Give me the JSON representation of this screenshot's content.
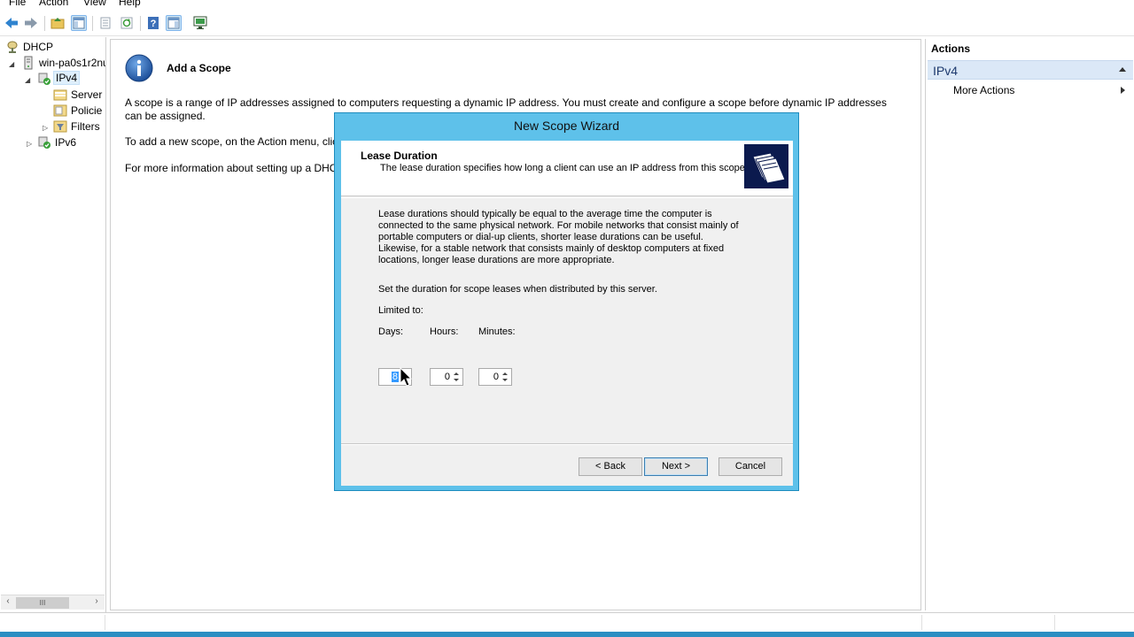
{
  "menu": [
    "File",
    "Action",
    "View",
    "Help"
  ],
  "tree": {
    "root": "DHCP",
    "server": "win-pa0s1r2nu",
    "ipv4": "IPv4",
    "children": [
      "Server",
      "Policie",
      "Filters"
    ],
    "ipv6": "IPv6"
  },
  "center": {
    "title": "Add a Scope",
    "p1": "A scope is a range of IP addresses assigned to computers requesting a dynamic IP address. You must create and configure a scope before dynamic IP addresses can be assigned.",
    "p2": "To add a new scope, on the Action menu, clic",
    "p3": "For more information about setting up a DHC"
  },
  "actions": {
    "header": "Actions",
    "section": "IPv4",
    "more": "More Actions"
  },
  "wizard": {
    "title": "New Scope Wizard",
    "heading": "Lease Duration",
    "subheading": "The lease duration specifies how long a client can use an IP address from this scope.",
    "description": [
      "Lease durations should typically be equal to the average time the computer is",
      "connected to the same physical network. For mobile networks that consist mainly of",
      "portable computers or dial-up clients, shorter lease durations can be useful.",
      "Likewise, for a stable network that consists mainly of desktop computers at fixed",
      "locations, longer lease durations are more appropriate."
    ],
    "set_text": "Set the duration for scope leases when distributed by this server.",
    "limited": "Limited to:",
    "days_label": "Days:",
    "hours_label": "Hours:",
    "minutes_label": "Minutes:",
    "days": "8",
    "hours": "0",
    "minutes": "0",
    "back": "< Back",
    "next": "Next >",
    "cancel": "Cancel"
  },
  "colors": {
    "wizard_frame": "#5ec1ea",
    "taskbar": "#2b8ec2",
    "actions_section": "#dbe8f7"
  }
}
